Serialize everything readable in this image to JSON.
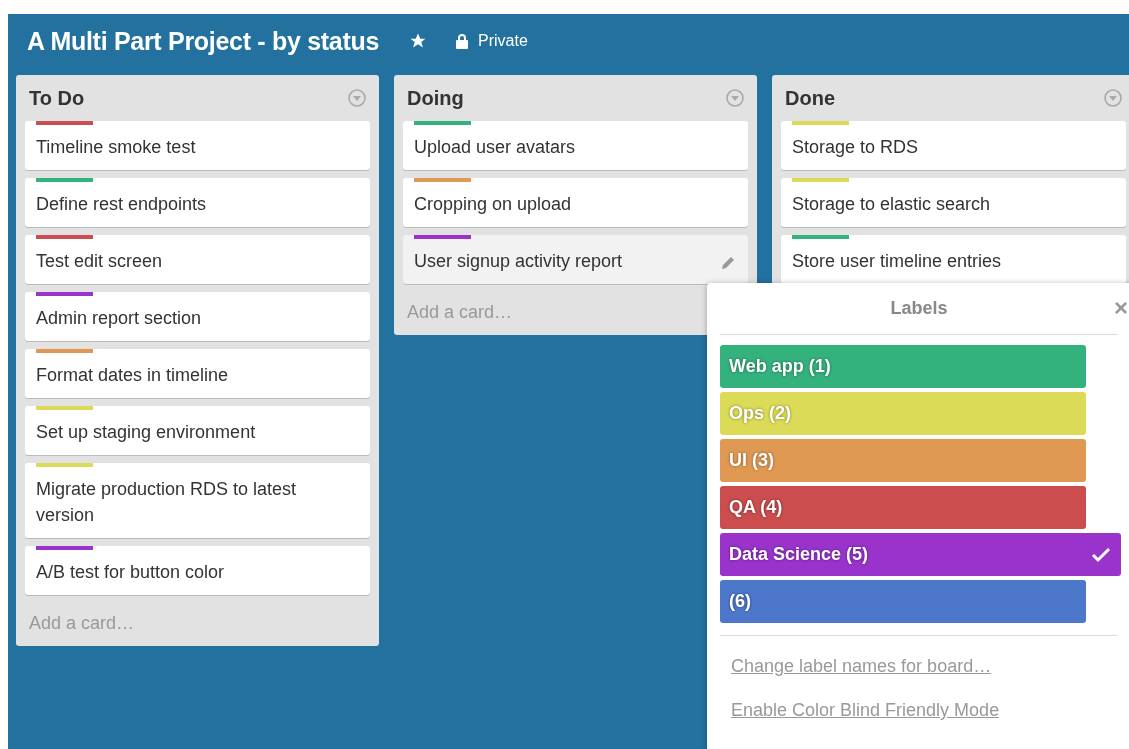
{
  "board": {
    "title": "A Multi Part Project - by status",
    "starred": true,
    "visibility": "Private"
  },
  "lists": [
    {
      "name": "To Do",
      "add_card": "Add a card…",
      "cards": [
        {
          "title": "Timeline smoke test",
          "color": "#cb4d4d",
          "hovered": false
        },
        {
          "title": "Define rest endpoints",
          "color": "#34b27d",
          "hovered": false
        },
        {
          "title": "Test edit screen",
          "color": "#cb4d4d",
          "hovered": false
        },
        {
          "title": "Admin report section",
          "color": "#9933cc",
          "hovered": false
        },
        {
          "title": "Format dates in timeline",
          "color": "#e09952",
          "hovered": false
        },
        {
          "title": "Set up staging environment",
          "color": "#dbdb57",
          "hovered": false
        },
        {
          "title": "Migrate production RDS to latest version",
          "color": "#dbdb57",
          "hovered": false
        },
        {
          "title": "A/B test for button color",
          "color": "#9933cc",
          "hovered": false
        }
      ]
    },
    {
      "name": "Doing",
      "add_card": "Add a card…",
      "cards": [
        {
          "title": "Upload user avatars",
          "color": "#34b27d",
          "hovered": false
        },
        {
          "title": "Cropping on upload",
          "color": "#e09952",
          "hovered": false
        },
        {
          "title": "User signup activity report",
          "color": "#9933cc",
          "hovered": true
        }
      ]
    },
    {
      "name": "Done",
      "cards": [
        {
          "title": "Storage to RDS",
          "color": "#dbdb57",
          "hovered": false
        },
        {
          "title": "Storage to elastic search",
          "color": "#dbdb57",
          "hovered": false
        },
        {
          "title": "Store user timeline entries",
          "color": "#34b27d",
          "hovered": false
        }
      ]
    }
  ],
  "labels_popover": {
    "title": "Labels",
    "close": "×",
    "labels": [
      {
        "name": "Web app (1)",
        "color": "#34b27d",
        "selected": false
      },
      {
        "name": "Ops (2)",
        "color": "#dbdb57",
        "selected": false
      },
      {
        "name": "UI (3)",
        "color": "#e09952",
        "selected": false
      },
      {
        "name": "QA (4)",
        "color": "#cb4d4d",
        "selected": false
      },
      {
        "name": "Data Science (5)",
        "color": "#9933cc",
        "selected": true
      },
      {
        "name": "(6)",
        "color": "#4d77cb",
        "selected": false
      }
    ],
    "links": [
      "Change label names for board…",
      "Enable Color Blind Friendly Mode"
    ]
  }
}
